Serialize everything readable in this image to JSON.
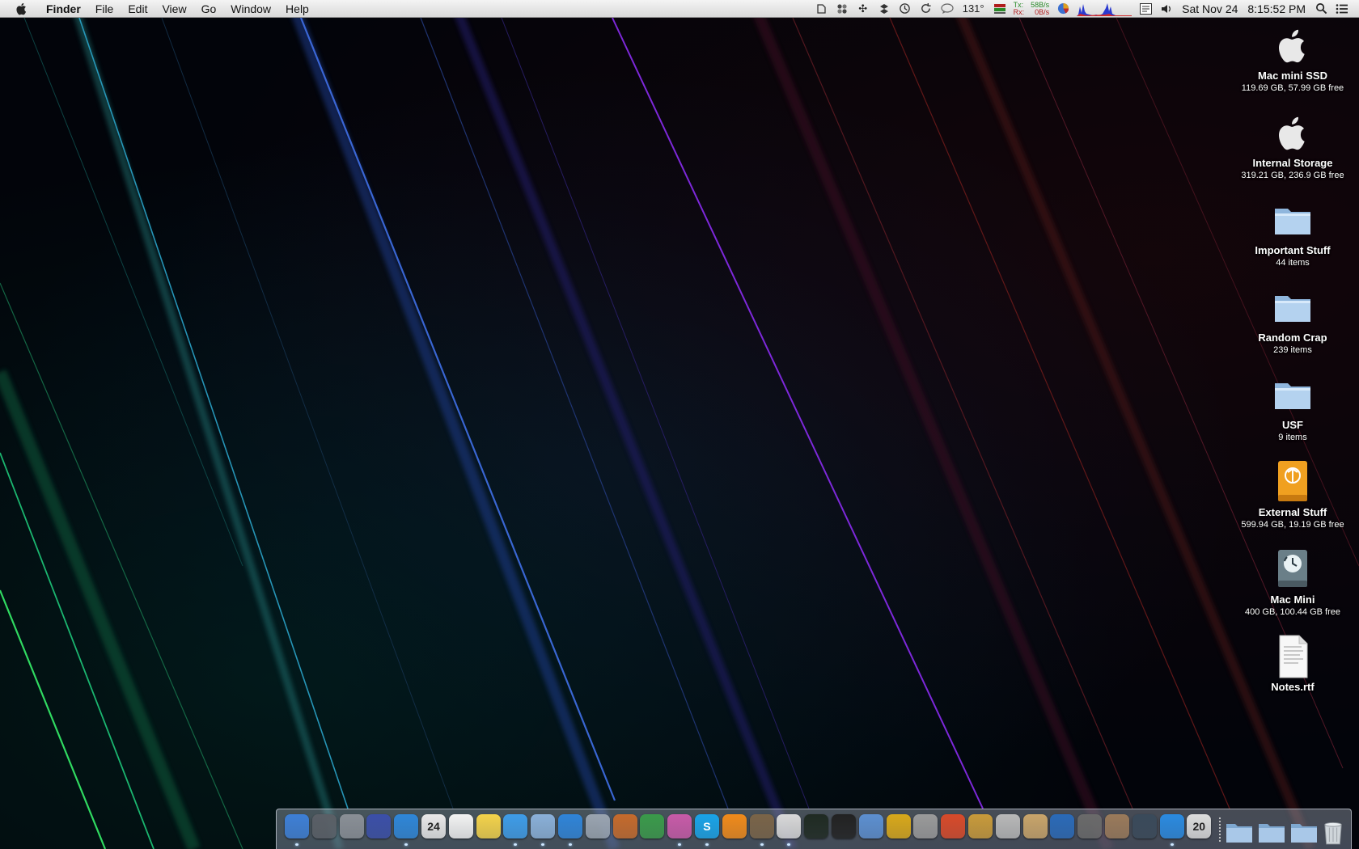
{
  "menubar": {
    "apple_menu": "apple-logo-icon",
    "app_name": "Finder",
    "menus": [
      "File",
      "Edit",
      "View",
      "Go",
      "Window",
      "Help"
    ],
    "status": {
      "temperature": "131°",
      "net_tx_label": "Tx:",
      "net_rx_label": "Rx:",
      "net_tx_value": "58B/s",
      "net_rx_value": "0B/s",
      "date": "Sat Nov 24",
      "time": "8:15:52 PM"
    }
  },
  "desktop": {
    "icons": [
      {
        "name": "Mac mini SSD",
        "info": "119.69 GB, 57.99 GB free",
        "icon": "apple-drive-icon"
      },
      {
        "name": "Internal Storage",
        "info": "319.21 GB, 236.9 GB free",
        "icon": "apple-drive-icon"
      },
      {
        "name": "Important Stuff",
        "info": "44 items",
        "icon": "folder-icon"
      },
      {
        "name": "Random Crap",
        "info": "239 items",
        "icon": "folder-icon"
      },
      {
        "name": "USF",
        "info": "9 items",
        "icon": "folder-icon"
      },
      {
        "name": "External Stuff",
        "info": "599.94 GB, 19.19 GB free",
        "icon": "firewire-drive-icon"
      },
      {
        "name": "Mac Mini",
        "info": "400 GB, 100.44 GB free",
        "icon": "time-machine-drive-icon"
      },
      {
        "name": "Notes.rtf",
        "info": "",
        "icon": "rtf-document-icon"
      }
    ]
  },
  "dock": {
    "apps": [
      {
        "icon": "finder-icon",
        "color": "#3d7fd6",
        "running": true
      },
      {
        "icon": "mission-control-icon",
        "color": "#5a5f66",
        "running": false
      },
      {
        "icon": "launchpad-icon",
        "color": "#8a8f96",
        "running": false
      },
      {
        "icon": "imovie-icon",
        "color": "#3b4fa8",
        "running": false
      },
      {
        "icon": "itunes-icon",
        "color": "#2e86d8",
        "running": true
      },
      {
        "icon": "calendar-icon",
        "color": "#e8e8e8",
        "running": false,
        "label": "24"
      },
      {
        "icon": "textedit-icon",
        "color": "#f2f2f2",
        "running": false
      },
      {
        "icon": "stickies-icon",
        "color": "#f3d24a",
        "running": false
      },
      {
        "icon": "messages-icon",
        "color": "#3e9ce8",
        "running": true
      },
      {
        "icon": "mail-icon",
        "color": "#8ab0d8",
        "running": true
      },
      {
        "icon": "safari-icon",
        "color": "#2f84d8",
        "running": true
      },
      {
        "icon": "script-editor-icon",
        "color": "#9aa4b0",
        "running": false
      },
      {
        "icon": "keynote-icon",
        "color": "#c56a2c",
        "running": false
      },
      {
        "icon": "numbers-icon",
        "color": "#3a9a4a",
        "running": false
      },
      {
        "icon": "istat-icon",
        "color": "#c85aa8",
        "running": true
      },
      {
        "icon": "skype-icon",
        "color": "#19a3e8",
        "running": true,
        "label": "S"
      },
      {
        "icon": "vlc-icon",
        "color": "#f08a1a",
        "running": false
      },
      {
        "icon": "image-capture-icon",
        "color": "#7a6448",
        "running": true
      },
      {
        "icon": "preview-icon",
        "color": "#d8d8d8",
        "running": true
      },
      {
        "icon": "activity-monitor-icon",
        "color": "#1f2a22",
        "running": false
      },
      {
        "icon": "terminal-icon",
        "color": "#222222",
        "running": false
      },
      {
        "icon": "xcode-icon",
        "color": "#5c8fd0",
        "running": false
      },
      {
        "icon": "wunderlist-icon",
        "color": "#d8a81a",
        "running": false
      },
      {
        "icon": "calculator-icon",
        "color": "#9a9a9a",
        "running": false
      },
      {
        "icon": "chrome-icon",
        "color": "#d84a2a",
        "running": false
      },
      {
        "icon": "pages-icon",
        "color": "#c89a3a",
        "running": false
      },
      {
        "icon": "pixelmator-icon",
        "color": "#b8b8b8",
        "running": false
      },
      {
        "icon": "contacts-icon",
        "color": "#c8a46a",
        "running": false
      },
      {
        "icon": "quicktime-icon",
        "color": "#2a6ab8",
        "running": false
      },
      {
        "icon": "iphoto-icon",
        "color": "#6a6a6a",
        "running": false
      },
      {
        "icon": "photo-booth-icon",
        "color": "#9a7a5a",
        "running": false
      },
      {
        "icon": "time-machine-icon",
        "color": "#3a4a5a",
        "running": false
      },
      {
        "icon": "app-store-icon",
        "color": "#2a8ae0",
        "running": true
      },
      {
        "icon": "speed-download-icon",
        "color": "#dcdcdc",
        "running": false,
        "label": "20"
      }
    ],
    "folders": [
      {
        "icon": "downloads-folder-icon"
      },
      {
        "icon": "documents-folder-icon"
      },
      {
        "icon": "applications-folder-icon"
      }
    ],
    "trash": "trash-icon"
  }
}
